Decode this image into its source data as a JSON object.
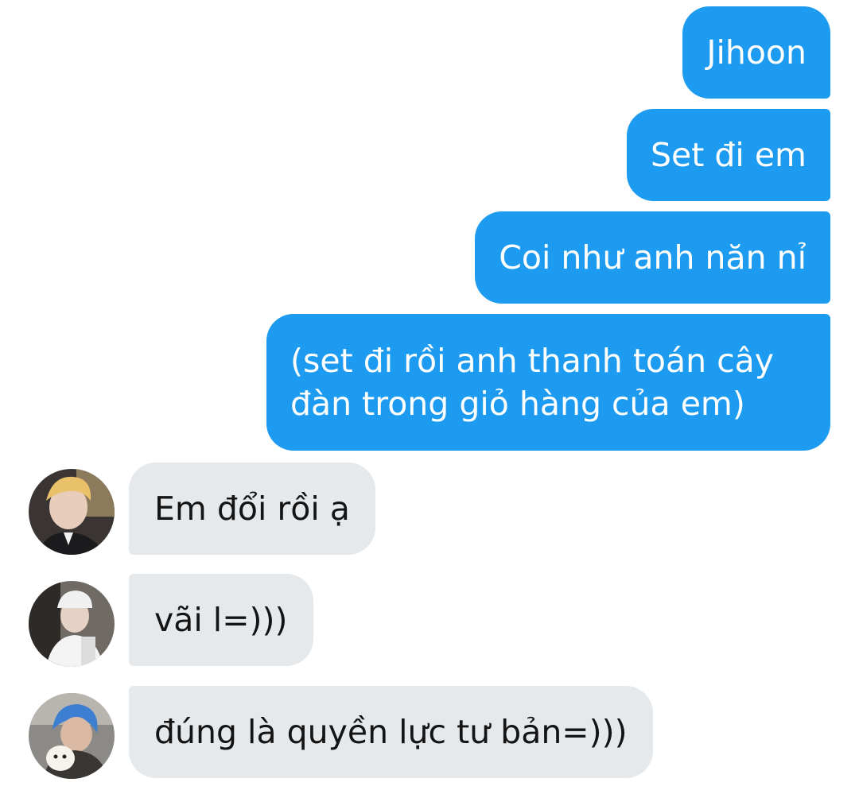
{
  "messages": {
    "outgoing": [
      {
        "text": "Jihoon"
      },
      {
        "text": "Set đi em"
      },
      {
        "text": "Coi như anh năn nỉ"
      },
      {
        "line1": "(set đi rồi anh thanh toán cây",
        "line2": "đàn trong giỏ hàng của em)"
      }
    ],
    "incoming": [
      {
        "text": "Em đổi rồi ạ"
      },
      {
        "text": "vãi l=)))"
      },
      {
        "text": "đúng là quyền lực tư bản=)))"
      }
    ]
  },
  "colors": {
    "outgoing_bubble": "#1d9bf0",
    "incoming_bubble": "#e6e9ec",
    "background": "#ffffff"
  },
  "icons": {
    "avatar_1": "avatar-blonde-suit",
    "avatar_2": "avatar-white-cap",
    "avatar_3": "avatar-blue-hair-dog"
  }
}
